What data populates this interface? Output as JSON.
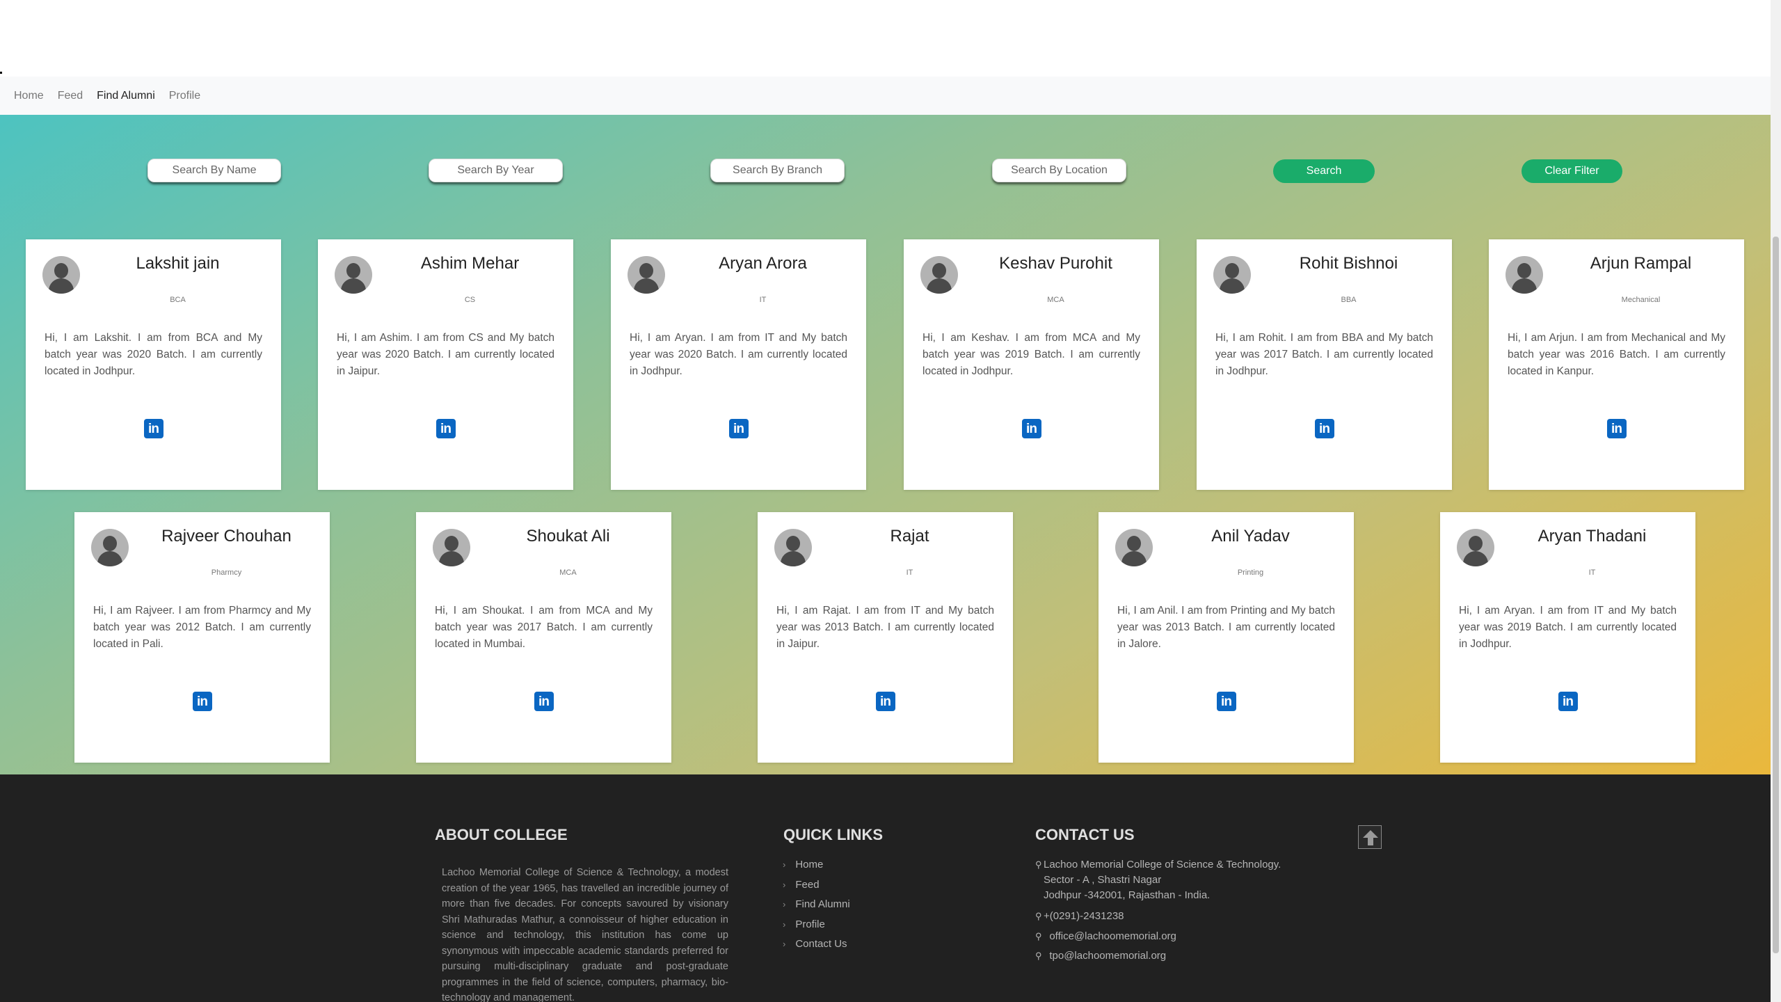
{
  "nav": {
    "items": [
      {
        "label": "Home",
        "active": false
      },
      {
        "label": "Feed",
        "active": false
      },
      {
        "label": "Find Alumni",
        "active": true
      },
      {
        "label": "Profile",
        "active": false
      }
    ]
  },
  "filters": {
    "name_placeholder": "Search By Name",
    "year_placeholder": "Search By Year",
    "branch_placeholder": "Search By Branch",
    "location_placeholder": "Search By Location",
    "search_label": "Search",
    "clear_label": "Clear Filter"
  },
  "colors": {
    "accent_green": "#1aac6a",
    "linkedin_blue": "#0a66c2",
    "footer_bg": "#212121"
  },
  "alumni": [
    {
      "name": "Lakshit jain",
      "branch": "BCA",
      "bio": "Hi, I am Lakshit. I am from BCA and My batch year was 2020 Batch. I am currently located in Jodhpur."
    },
    {
      "name": "Ashim Mehar",
      "branch": "CS",
      "bio": "Hi, I am Ashim. I am from CS and My batch year was 2020 Batch. I am currently located in Jaipur."
    },
    {
      "name": "Aryan Arora",
      "branch": "IT",
      "bio": "Hi, I am Aryan. I am from IT and My batch year was 2020 Batch. I am currently located in Jodhpur."
    },
    {
      "name": "Keshav Purohit",
      "branch": "MCA",
      "bio": "Hi, I am Keshav. I am from MCA and My batch year was 2019 Batch. I am currently located in Jodhpur."
    },
    {
      "name": "Rohit Bishnoi",
      "branch": "BBA",
      "bio": "Hi, I am Rohit. I am from BBA and My batch year was 2017 Batch. I am currently located in Jodhpur."
    },
    {
      "name": "Arjun Rampal",
      "branch": "Mechanical",
      "bio": "Hi, I am Arjun. I am from Mechanical and My batch year was 2016 Batch. I am currently located in Kanpur."
    },
    {
      "name": "Rajveer Chouhan",
      "branch": "Pharmcy",
      "bio": "Hi, I am Rajveer. I am from Pharmcy and My batch year was 2012 Batch. I am currently located in Pali."
    },
    {
      "name": "Shoukat Ali",
      "branch": "MCA",
      "bio": "Hi, I am Shoukat. I am from MCA and My batch year was 2017 Batch. I am currently located in Mumbai."
    },
    {
      "name": "Rajat",
      "branch": "IT",
      "bio": "Hi, I am Rajat. I am from IT and My batch year was 2013 Batch. I am currently located in Jaipur."
    },
    {
      "name": "Anil Yadav",
      "branch": "Printing",
      "bio": "Hi, I am Anil. I am from Printing and My batch year was 2013 Batch. I am currently located in Jalore."
    },
    {
      "name": "Aryan Thadani",
      "branch": "IT",
      "bio": "Hi, I am Aryan. I am from IT and My batch year was 2019 Batch. I am currently located in Jodhpur."
    }
  ],
  "footer": {
    "about_title": "ABOUT COLLEGE",
    "about_text": "Lachoo Memorial College of Science & Technology, a modest creation of the year 1965, has travelled an incredible journey of more than five decades. For concepts savoured by visionary Shri Mathuradas Mathur, a connoisseur of higher education in science and technology, this institution has come up synonymous with impeccable academic standards preferred for pursuing multi-disciplinary graduate and post-graduate programmes in the field of science, computers, pharmacy, bio-technology and management.",
    "links_title": "QUICK LINKS",
    "links": [
      "Home",
      "Feed",
      "Find Alumni",
      "Profile",
      "Contact Us"
    ],
    "contact_title": "CONTACT US",
    "address_line1": "Lachoo Memorial College of Science & Technology.",
    "address_line2": "Sector - A , Shastri Nagar",
    "address_line3": "Jodhpur -342001, Rajasthan - India.",
    "phone": "+(0291)-2431238",
    "email1": "office@lachoomemorial.org",
    "email2": "tpo@lachoomemorial.org"
  }
}
